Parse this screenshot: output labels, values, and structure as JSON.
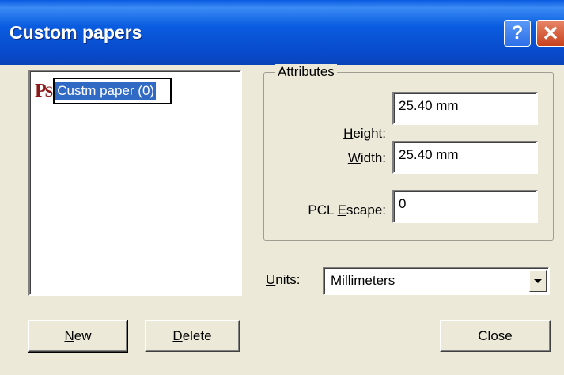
{
  "window": {
    "title": "Custom papers",
    "help_label": "?",
    "close_label": "✕"
  },
  "list": {
    "items": [
      {
        "icon": "ps-icon",
        "label": "Custm paper (0)",
        "selected": true
      }
    ]
  },
  "attributes": {
    "legend": "Attributes",
    "height": {
      "label_u": "H",
      "label_rest": "eight:",
      "value": "25.40 mm"
    },
    "width": {
      "label_u": "W",
      "label_rest": "idth:",
      "value": "25.40 mm"
    },
    "pcl": {
      "label_pre": "PCL ",
      "label_u": "E",
      "label_rest": "scape:",
      "value": "0"
    }
  },
  "units": {
    "label_u": "U",
    "label_rest": "nits:",
    "selected": "Millimeters"
  },
  "buttons": {
    "new": {
      "u": "N",
      "rest": "ew"
    },
    "delete": {
      "u": "D",
      "rest": "elete"
    },
    "close": "Close"
  },
  "colors": {
    "titlebar": "#0a5ce0",
    "selection": "#316ac5",
    "face": "#ece9d8"
  }
}
